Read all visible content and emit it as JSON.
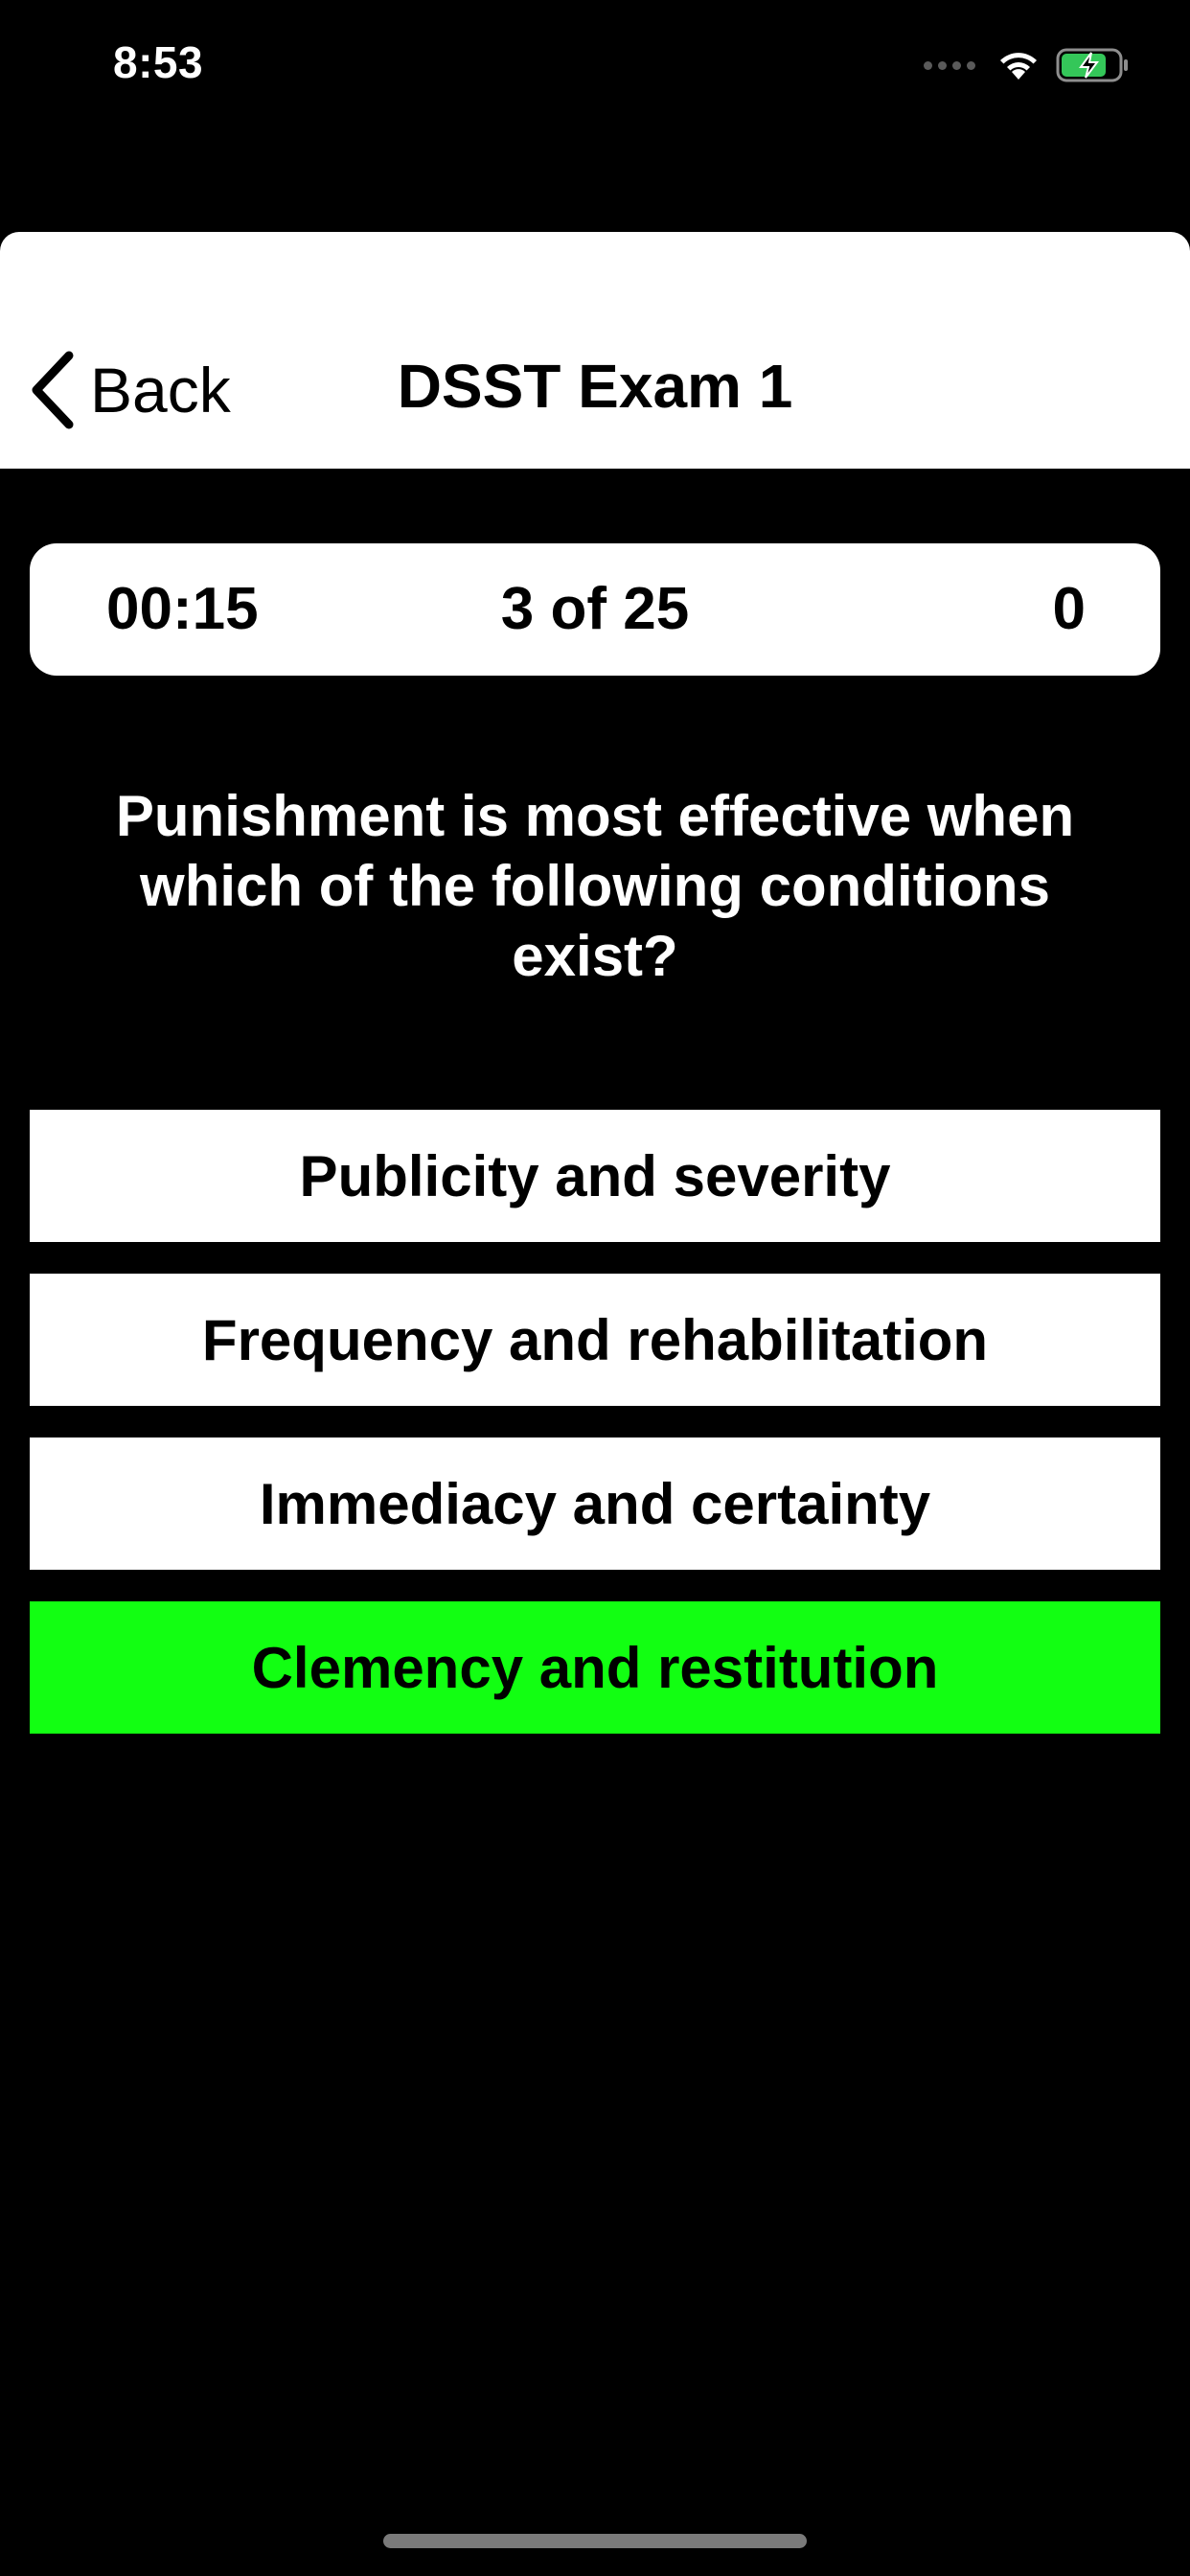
{
  "status_bar": {
    "time": "8:53",
    "icons": [
      "signal-icon",
      "wifi-icon",
      "battery-charging-icon"
    ],
    "battery_color": "#34c759"
  },
  "nav": {
    "back_label": "Back",
    "title": "DSST Exam 1"
  },
  "stats": {
    "timer": "00:15",
    "progress": "3 of 25",
    "score": "0"
  },
  "question": {
    "text": "Punishment is most effective when which of the following conditions exist?"
  },
  "answers": [
    {
      "label": "Publicity and severity",
      "selected": false
    },
    {
      "label": "Frequency and rehabilitation",
      "selected": false
    },
    {
      "label": "Immediacy and certainty",
      "selected": false
    },
    {
      "label": "Clemency and restitution",
      "selected": true
    }
  ],
  "colors": {
    "background": "#000000",
    "card": "#ffffff",
    "selected_answer": "#12ff12"
  }
}
